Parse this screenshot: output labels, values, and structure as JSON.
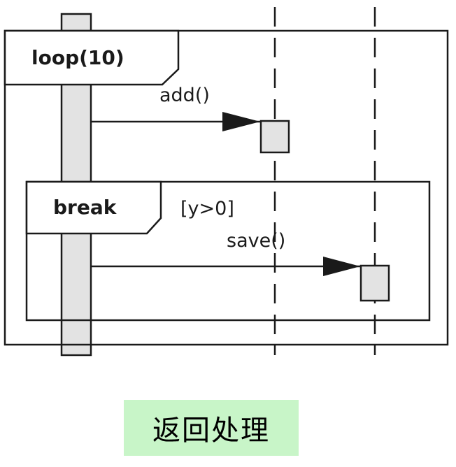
{
  "diagram": {
    "loop_fragment": {
      "operator": "loop(10)"
    },
    "break_fragment": {
      "operator": "break",
      "guard": "[y>0]"
    },
    "messages": [
      {
        "label": "add()",
        "from": "lifeline-1",
        "to": "lifeline-2"
      },
      {
        "label": "save()",
        "from": "lifeline-1",
        "to": "lifeline-3"
      }
    ],
    "colors": {
      "activation_fill": "#e3e3e3",
      "line": "#1a1a1a",
      "caption_bg": "#c8f5c8"
    }
  },
  "caption": {
    "text": "返回处理"
  }
}
